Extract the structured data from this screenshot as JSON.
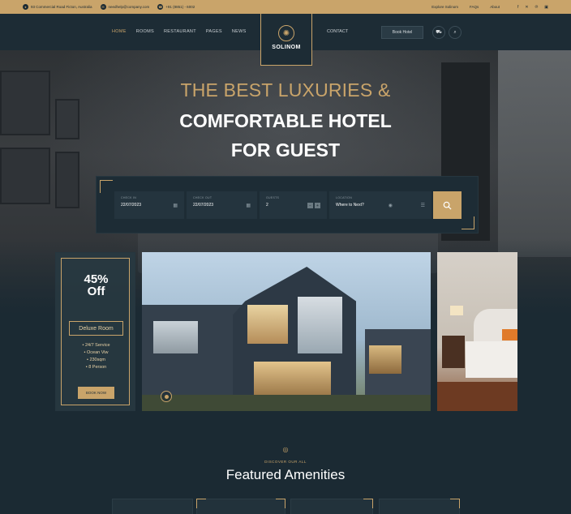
{
  "topbar": {
    "address": "93 Commercial Road Ficton, Australia",
    "email": "needhelp@company.com",
    "phone": "+91 (8851) - 6002",
    "links": [
      "Explore Solinom",
      "FAQs",
      "About"
    ],
    "social_icons": [
      "facebook-icon",
      "x-icon",
      "pinterest-icon",
      "instagram-icon"
    ]
  },
  "nav": {
    "items": [
      "HOME",
      "ROOMS",
      "RESTAURANT",
      "PAGES",
      "NEWS"
    ],
    "contact": "CONTACT",
    "book_label": "Book Hotel",
    "logo_text": "SOLINOM",
    "active": "HOME"
  },
  "hero": {
    "line1": "THE BEST LUXURIES &",
    "line2": "COMFORTABLE HOTEL",
    "line3": "FOR GUEST"
  },
  "booking": {
    "checkin_label": "CHECK IN",
    "checkin_value": "22/07/2023",
    "checkout_label": "CHECK OUT",
    "checkout_value": "22/07/2023",
    "guests_label": "GUESTS",
    "guests_value": "2",
    "location_label": "LOCATION",
    "location_value": "Where to Next?"
  },
  "promo": {
    "discount": "45%",
    "off": "Off",
    "room": "Deluxe Room",
    "features": [
      "24/7 Service",
      "Ocean Viw",
      "230sqm",
      "8 Person"
    ],
    "button": "BOOK NOW"
  },
  "amenities": {
    "eyebrow": "DISCOVER OUR ALL",
    "title": "Featured Amenities"
  },
  "colors": {
    "accent": "#c9a46a",
    "dark": "#1b2a33"
  }
}
